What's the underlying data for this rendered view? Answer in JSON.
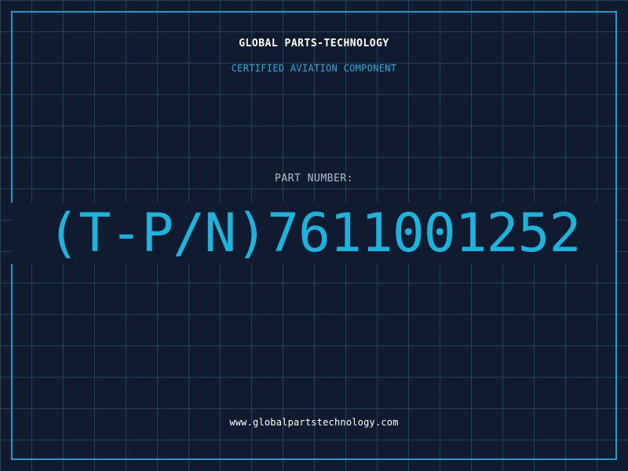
{
  "company_name": "GLOBAL PARTS-TECHNOLOGY",
  "subtitle": "CERTIFIED AVIATION COMPONENT",
  "part_label": "PART NUMBER:",
  "part_number": "(T-P/N)7611001252",
  "website": "www.globalpartstechnology.com",
  "colors": {
    "background": "#111b2f",
    "grid": "#1f4257",
    "border": "#1f9ccc",
    "accent": "#1ab5de",
    "title": "#ffffff",
    "label": "#b3bcc9"
  }
}
